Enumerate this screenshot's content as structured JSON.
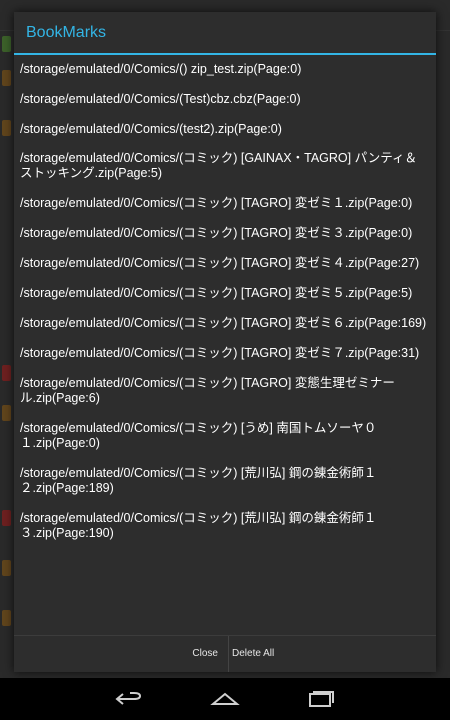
{
  "dialog": {
    "title": "BookMarks",
    "items": [
      {
        "text": "/storage/emulated/0/Comics/() zip_test.zip(Page:0)"
      },
      {
        "text": "/storage/emulated/0/Comics/(Test)cbz.cbz(Page:0)"
      },
      {
        "text": "/storage/emulated/0/Comics/(test2).zip(Page:0)"
      },
      {
        "text": "/storage/emulated/0/Comics/(コミック) [GAINAX・TAGRO] パンティ＆ストッキング.zip(Page:5)"
      },
      {
        "text": "/storage/emulated/0/Comics/(コミック) [TAGRO] 変ゼミ１.zip(Page:0)"
      },
      {
        "text": "/storage/emulated/0/Comics/(コミック) [TAGRO] 変ゼミ３.zip(Page:0)"
      },
      {
        "text": "/storage/emulated/0/Comics/(コミック) [TAGRO] 変ゼミ４.zip(Page:27)"
      },
      {
        "text": "/storage/emulated/0/Comics/(コミック) [TAGRO] 変ゼミ５.zip(Page:5)"
      },
      {
        "text": "/storage/emulated/0/Comics/(コミック) [TAGRO] 変ゼミ６.zip(Page:169)"
      },
      {
        "text": "/storage/emulated/0/Comics/(コミック) [TAGRO] 変ゼミ７.zip(Page:31)"
      },
      {
        "text": "/storage/emulated/0/Comics/(コミック) [TAGRO] 変態生理ゼミナール.zip(Page:6)"
      },
      {
        "text": "/storage/emulated/0/Comics/(コミック) [うめ] 南国トムソーヤ０１.zip(Page:0)"
      },
      {
        "text": "/storage/emulated/0/Comics/(コミック) [荒川弘] 鋼の錬金術師１２.zip(Page:189)"
      },
      {
        "text": "/storage/emulated/0/Comics/(コミック) [荒川弘] 鋼の錬金術師１３.zip(Page:190)"
      }
    ],
    "buttons": {
      "close": "Close",
      "delete_all": "Delete All"
    }
  },
  "navbar": {
    "back_icon": "back-icon",
    "home_icon": "home-icon",
    "recents_icon": "recents-icon"
  },
  "colors": {
    "accent": "#33b5e5",
    "dialog_bg": "#2d2d2d",
    "text": "#ffffff"
  }
}
